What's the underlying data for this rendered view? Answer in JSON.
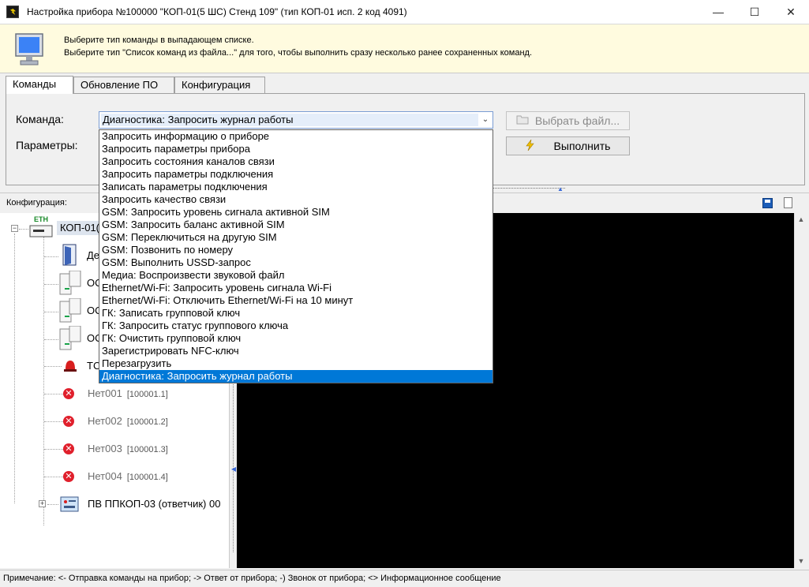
{
  "window": {
    "title": "Настройка прибора №100000 \"КОП-01(5 ШС) Стенд 109\" (тип КОП-01 исп. 2 код 4091)",
    "minimize": "—",
    "maximize": "☐",
    "close": "✕"
  },
  "hint": {
    "line1": "Выберите тип команды в выпадающем списке.",
    "line2": "Выберите тип \"Список команд из файла...\" для того, чтобы выполнить сразу несколько ранее сохраненных команд."
  },
  "tabs": [
    {
      "label": "Команды"
    },
    {
      "label": "Обновление ПО"
    },
    {
      "label": "Конфигурация"
    }
  ],
  "command": {
    "label": "Команда:",
    "params_label": "Параметры:",
    "selected": "Диагностика: Запросить журнал работы",
    "choose_file_button": "Выбрать файл...",
    "execute_button": "Выполнить",
    "options": [
      "Запросить информацию о приборе",
      "Запросить параметры прибора",
      "Запросить состояния каналов связи",
      "Запросить параметры подключения",
      "Записать параметры подключения",
      "Запросить качество связи",
      "GSM: Запросить уровень сигнала активной SIM",
      "GSM: Запросить баланс активной SIM",
      "GSM: Переключиться на другую SIM",
      "GSM: Позвонить по номеру",
      "GSM: Выполнить USSD-запрос",
      "Медиа: Воспроизвести звуковой файл",
      "Ethernet/Wi-Fi: Запросить уровень сигнала Wi-Fi",
      "Ethernet/Wi-Fi: Отключить Ethernet/Wi-Fi на 10 минут",
      "ГК: Записать групповой ключ",
      "ГК: Запросить статус группового ключа",
      "ГК: Очистить групповой ключ",
      "Зарегистрировать NFC-ключ",
      "Перезагрузить",
      "Диагностика: Запросить журнал работы"
    ],
    "selected_index": 19
  },
  "config": {
    "label": "Конфигурация:"
  },
  "tree": {
    "root": {
      "label": "КОП-01(",
      "badge": "ETH"
    },
    "children_partial": [
      "Де",
      "ОС",
      "ОС",
      "ОС",
      "ТС"
    ],
    "offline": [
      {
        "name": "Нет001",
        "addr": "[100001.1]"
      },
      {
        "name": "Нет002",
        "addr": "[100001.2]"
      },
      {
        "name": "Нет003",
        "addr": "[100001.3]"
      },
      {
        "name": "Нет004",
        "addr": "[100001.4]"
      }
    ],
    "last": {
      "label": "ПВ ППКОП-03 (ответчик) 00"
    }
  },
  "status": {
    "text": "Примечание:  <- Отправка команды на прибор; -> Ответ от прибора; -) Звонок от прибора; <> Информационное сообщение"
  },
  "colors": {
    "hint_bg": "#fffbdf",
    "selection": "#0078d7",
    "log_bg": "#000000"
  }
}
